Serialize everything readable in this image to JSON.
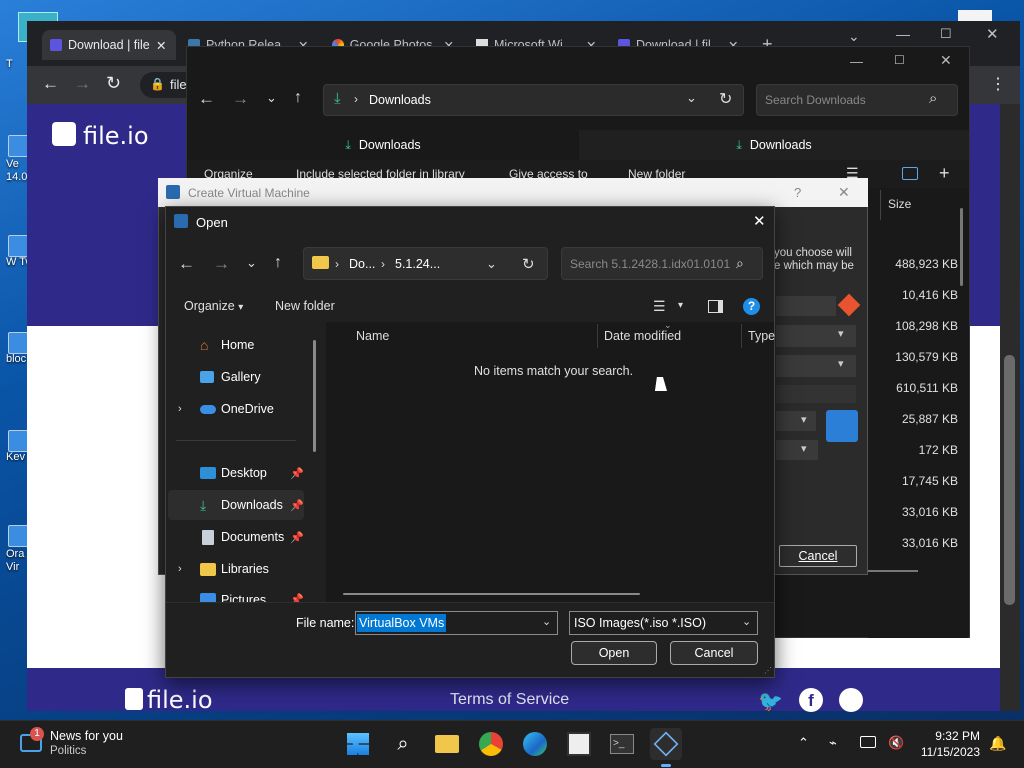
{
  "chrome": {
    "tabs": [
      {
        "label": "Download | file",
        "active": true
      },
      {
        "label": "Python Relea",
        "active": false
      },
      {
        "label": "Google Photos",
        "active": false
      },
      {
        "label": "Microsoft Wi",
        "active": false
      },
      {
        "label": "Download | fil",
        "active": false
      }
    ],
    "new_tab": "+",
    "omnibox_text": "file",
    "site_logo": "file.io",
    "footer_logo": "file.io",
    "footer_link": "Terms of Service"
  },
  "explorer": {
    "address": "Downloads",
    "search_placeholder": "Search Downloads",
    "tabs": [
      "Downloads",
      "Downloads"
    ],
    "commands": [
      "Organize",
      "Include selected folder in library",
      "Give access to",
      "New folder"
    ],
    "size_header": "Size",
    "sizes": [
      "488,923 KB",
      "10,416 KB",
      "108,298 KB",
      "130,579 KB",
      "610,511 KB",
      "25,887 KB",
      "172 KB",
      "17,745 KB",
      "33,016 KB",
      "33,016 KB"
    ]
  },
  "create_vm": {
    "title": "Create Virtual Machine",
    "help_btn": "?",
    "text_line1": "you choose will",
    "text_line2": "e which may be",
    "cancel": "Cancel"
  },
  "open_dialog": {
    "title": "Open",
    "breadcrumb": [
      "Do...",
      "5.1.24..."
    ],
    "search_placeholder": "Search 5.1.2428.1.idx01.0101...",
    "organize": "Organize",
    "new_folder": "New folder",
    "nav_items": [
      "Home",
      "Gallery",
      "OneDrive",
      "Desktop",
      "Downloads",
      "Documents",
      "Libraries",
      "Pictures"
    ],
    "columns": [
      "Name",
      "Date modified",
      "Type"
    ],
    "empty_message": "No items match your search.",
    "file_name_label": "File name:",
    "file_name_value": "VirtualBox VMs",
    "file_type": "ISO Images(*.iso *.ISO)",
    "open_btn": "Open",
    "cancel_btn": "Cancel"
  },
  "desktop_icons": [
    "T",
    "Ve 14.0",
    "W Tw",
    "bloc",
    "Kev",
    "Ora Vir"
  ],
  "taskbar": {
    "news_title": "News for you",
    "news_sub": "Politics",
    "news_badge": "1",
    "time": "9:32 PM",
    "date": "11/15/2023"
  },
  "colors": {
    "accent": "#2f2a8a",
    "download_green": "#3cc38a",
    "select_blue": "#0078d4"
  }
}
